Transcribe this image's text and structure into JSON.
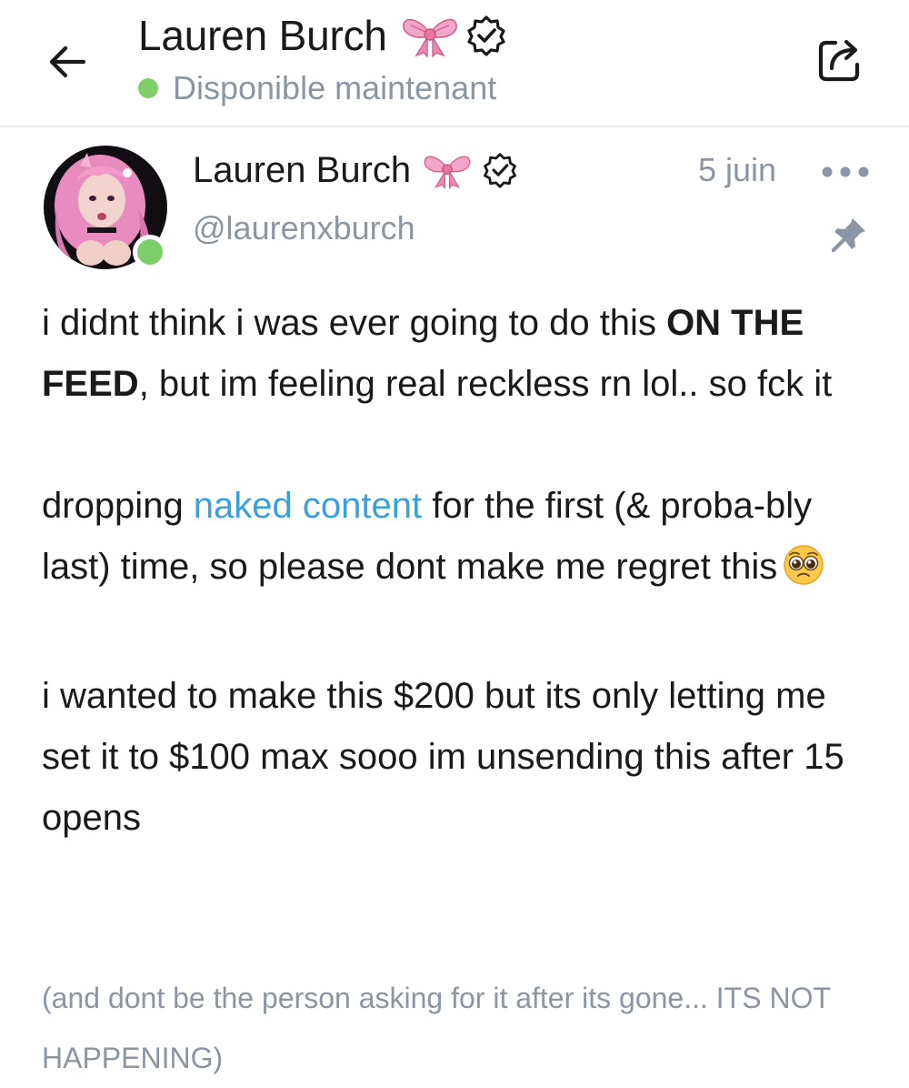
{
  "header": {
    "name": "Lauren Burch",
    "status": "Disponible maintenant"
  },
  "post": {
    "author_name": "Lauren Burch",
    "handle": "@laurenxburch",
    "date": "5 juin",
    "body": {
      "p1_a": "i didnt think i was ever going to do this ",
      "p1_bold": "ON THE FEED",
      "p1_b": ", but im feeling real reckless rn lol.. so fck it",
      "p2_a": "dropping ",
      "p2_link": "naked content",
      "p2_b": " for the first (& proba-bly last) time, so please dont make me regret this",
      "p3": "i wanted to make this $200 but its only letting me set it to $100 max sooo im unsending this after 15 opens",
      "note": "(and dont be the person asking for it after its gone... ITS NOT HAPPENING)"
    }
  },
  "icons": {
    "back": "arrow-left-icon",
    "share": "share-icon",
    "bow": "bow-emoji-icon",
    "verified": "verified-badge-icon",
    "more": "more-dots-icon",
    "pin": "pin-icon",
    "pleading": "pleading-face-emoji-icon"
  },
  "colors": {
    "link": "#3aa0dc",
    "online": "#7fce6a",
    "muted": "#8a96a3"
  }
}
